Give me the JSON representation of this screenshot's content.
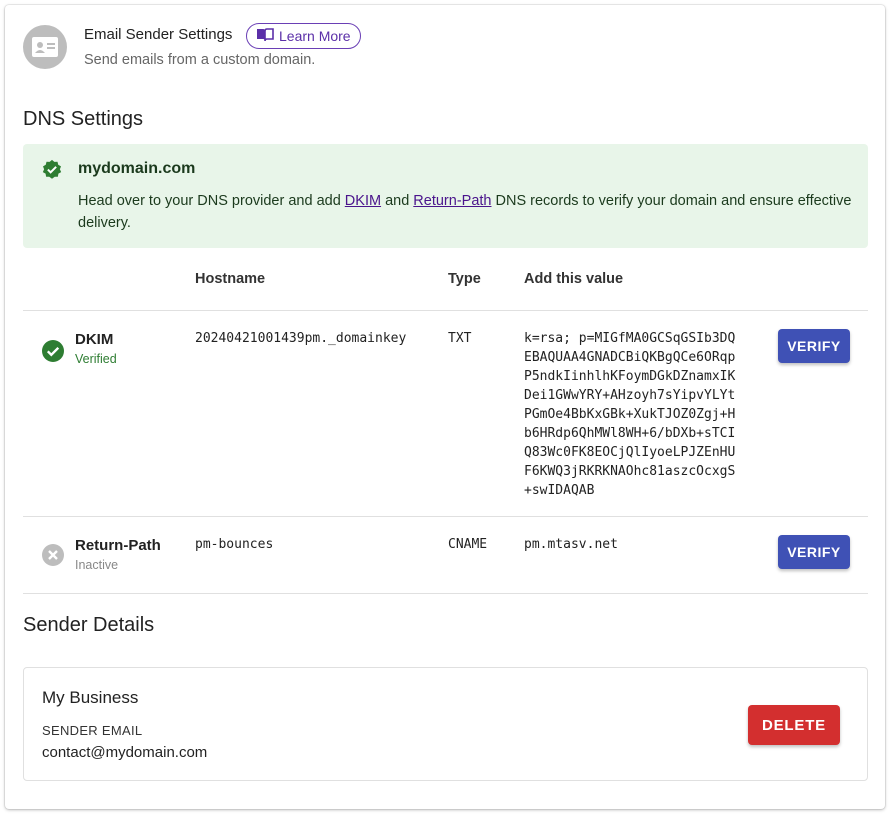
{
  "header": {
    "title": "Email Sender Settings",
    "learn_more_label": "Learn More",
    "subtitle": "Send emails from a custom domain."
  },
  "dns": {
    "section_title": "DNS Settings",
    "alert": {
      "domain": "mydomain.com",
      "text_before": "Head over to your DNS provider and add ",
      "link_dkim": "DKIM",
      "text_and": " and ",
      "link_return_path": "Return-Path",
      "text_after": " DNS records to verify your domain and ensure effective delivery."
    },
    "columns": [
      "Hostname",
      "Type",
      "Add this value"
    ],
    "records": [
      {
        "name": "DKIM",
        "status": "Verified",
        "hostname": "20240421001439pm._domainkey",
        "type": "TXT",
        "value": "k=rsa; p=MIGfMA0GCSqGSIb3DQ\nEBAQUAA4GNADCBiQKBgQCe6ORqp\nP5ndkIinhlhKFoymDGkDZnamxIK\nDei1GWwYRY+AHzoyh7sYipvYLYt\nPGmOe4BbKxGBk+XukTJOZ0Zgj+H\nb6HRdp6QhMWl8WH+6/bDXb+sTCI\nQ83Wc0FK8EOCjQlIyoeLPJZEnHU\nF6KWQ3jRKRKNAOhc81aszcOcxgS\n+swIDAQAB",
        "button": "VERIFY"
      },
      {
        "name": "Return-Path",
        "status": "Inactive",
        "hostname": "pm-bounces",
        "type": "CNAME",
        "value": "pm.mtasv.net",
        "button": "VERIFY"
      }
    ]
  },
  "sender": {
    "section_title": "Sender Details",
    "name": "My Business",
    "email_label": "SENDER EMAIL",
    "email": "contact@mydomain.com",
    "delete_label": "DELETE"
  },
  "colors": {
    "primary": "#3f51b5",
    "danger": "#d32f2f",
    "success": "#2e7d32",
    "alert_bg": "#e8f5e9",
    "link": "#4a148c",
    "outline_accent": "#6a3fb5"
  },
  "icons": {
    "header": "contact-card-icon",
    "learn_more": "book-icon",
    "alert": "verified-badge-icon",
    "dkim_status": "check-circle-icon",
    "return_path_status": "cancel-circle-icon"
  }
}
